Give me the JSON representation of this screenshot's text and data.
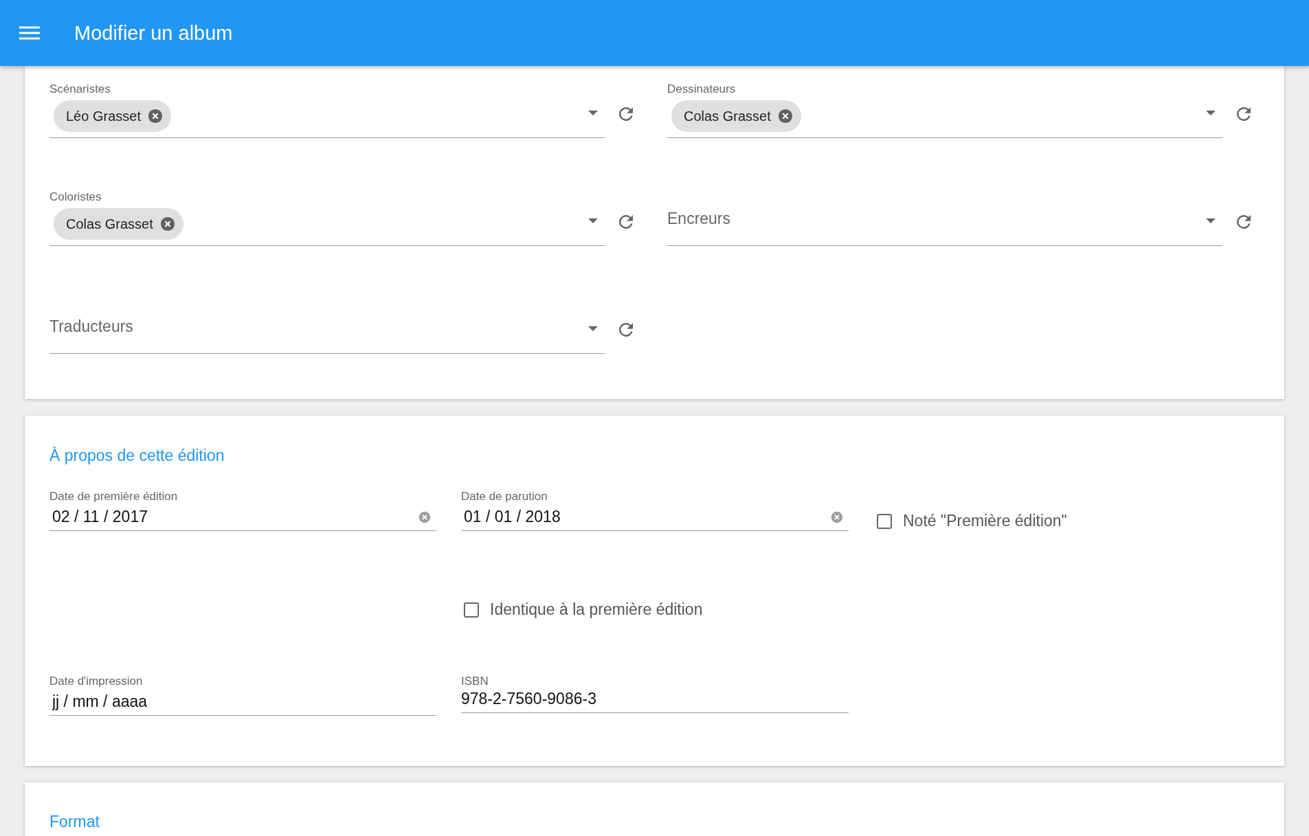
{
  "app_bar": {
    "title": "Modifier un album"
  },
  "people_card": {
    "fields": [
      {
        "label": "Scénaristes",
        "chips": [
          "Léo Grasset"
        ]
      },
      {
        "label": "Dessinateurs",
        "chips": [
          "Colas Grasset"
        ]
      },
      {
        "label": "Coloristes",
        "chips": [
          "Colas Grasset"
        ]
      },
      {
        "label": "Encreurs"
      },
      {
        "label": "Traducteurs"
      }
    ]
  },
  "edition_card": {
    "title": "À propos de cette édition",
    "fields": [
      {
        "kind": "date",
        "label": "Date de première édition",
        "value": "02 / 11 / 2017"
      },
      {
        "kind": "date",
        "label": "Date de parution",
        "value": "01 / 01 / 2018"
      },
      {
        "kind": "checkbox",
        "label": "Noté \"Première édition\"",
        "checked": false
      },
      {
        "kind": "spacer"
      },
      {
        "kind": "checkbox",
        "label": "Identique à la première édition",
        "checked": false
      },
      {
        "kind": "spacer"
      },
      {
        "kind": "date",
        "label": "Date d'impression",
        "placeholder": "jj / mm / aaaa"
      },
      {
        "kind": "text",
        "label": "ISBN",
        "value": "978-2-7560-9086-3"
      }
    ]
  },
  "format_card": {
    "title": "Format"
  }
}
